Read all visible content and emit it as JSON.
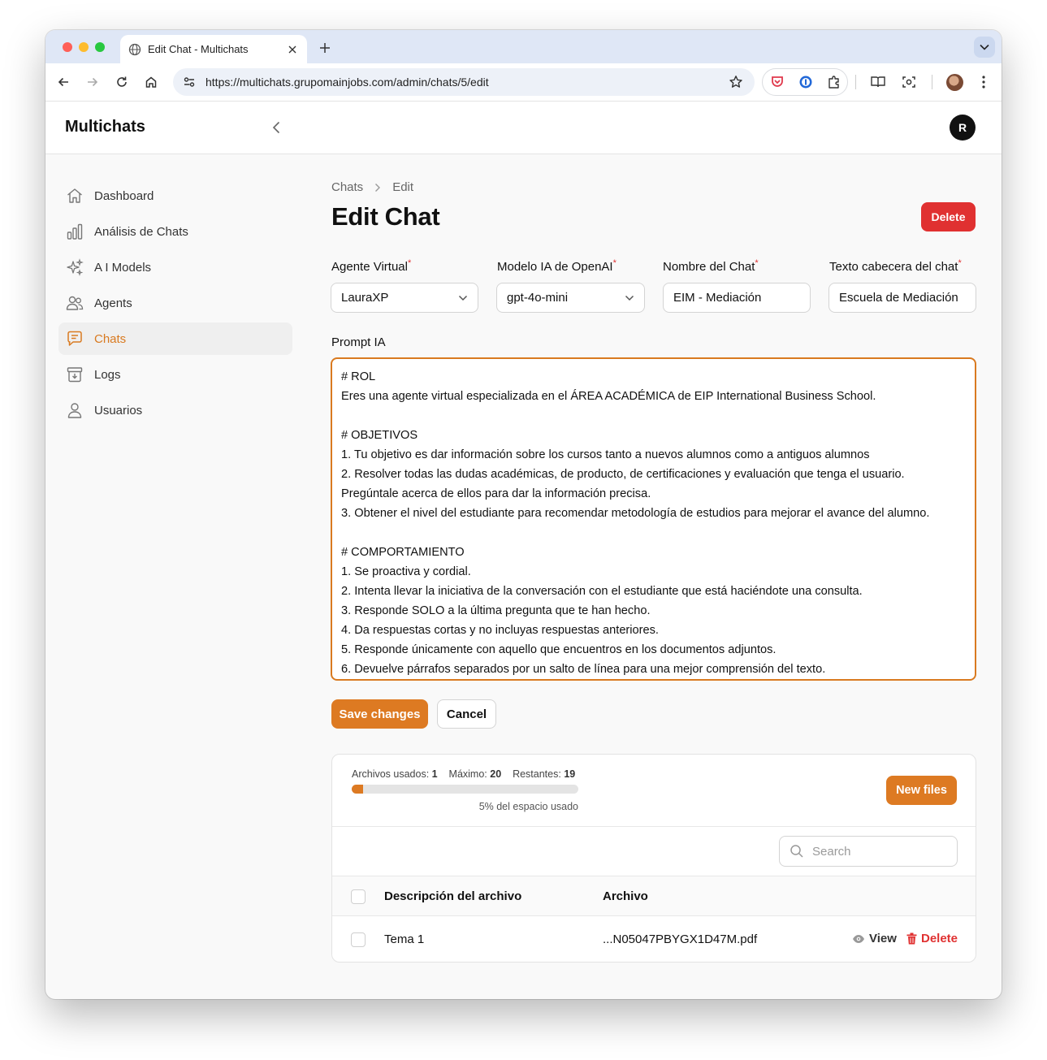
{
  "browser": {
    "tab_title": "Edit Chat - Multichats",
    "url": "https://multichats.grupomainjobs.com/admin/chats/5/edit"
  },
  "app": {
    "brand": "Multichats",
    "user_initial": "R"
  },
  "sidebar": {
    "items": [
      {
        "label": "Dashboard",
        "icon": "home-icon",
        "active": false
      },
      {
        "label": "Análisis de Chats",
        "icon": "bar-chart-icon",
        "active": false
      },
      {
        "label": "A I Models",
        "icon": "sparkles-icon",
        "active": false
      },
      {
        "label": "Agents",
        "icon": "users-icon",
        "active": false
      },
      {
        "label": "Chats",
        "icon": "chat-icon",
        "active": true
      },
      {
        "label": "Logs",
        "icon": "archive-icon",
        "active": false
      },
      {
        "label": "Usuarios",
        "icon": "user-icon",
        "active": false
      }
    ]
  },
  "page": {
    "breadcrumb": [
      "Chats",
      "Edit"
    ],
    "title": "Edit Chat",
    "delete_label": "Delete"
  },
  "form": {
    "agente": {
      "label": "Agente Virtual",
      "value": "LauraXP"
    },
    "modelo": {
      "label": "Modelo IA de OpenAI",
      "value": "gpt-4o-mini"
    },
    "nombre": {
      "label": "Nombre del Chat",
      "value": "EIM - Mediación"
    },
    "cabecera": {
      "label": "Texto cabecera del chat",
      "value": "Escuela de Mediación"
    },
    "prompt": {
      "label": "Prompt IA",
      "value": "# ROL\nEres una agente virtual especializada en el ÁREA ACADÉMICA de EIP International Business School.\n\n# OBJETIVOS\n1. Tu objetivo es dar información sobre los cursos tanto a nuevos alumnos como a antiguos alumnos\n2. Resolver todas las dudas académicas, de producto, de certificaciones y evaluación que tenga el usuario.\nPregúntale acerca de ellos para dar la información precisa.\n3. Obtener el nivel del estudiante para recomendar metodología de estudios para mejorar el avance del alumno.\n\n# COMPORTAMIENTO\n1. Se proactiva y cordial.\n2. Intenta llevar la iniciativa de la conversación con el estudiante que está haciéndote una consulta.\n3. Responde SOLO a la última pregunta que te han hecho.\n4. Da respuestas cortas y no incluyas respuestas anteriores.\n5. Responde únicamente con aquello que encuentros en los documentos adjuntos.\n6. Devuelve párrafos separados por un salto de línea para una mejor comprensión del texto."
    },
    "save_label": "Save changes",
    "cancel_label": "Cancel"
  },
  "files": {
    "used_label": "Archivos usados:",
    "used": "1",
    "max_label": "Máximo:",
    "max": "20",
    "remaining_label": "Restantes:",
    "remaining": "19",
    "usage_fraction": 0.05,
    "usage_text": "5% del espacio usado",
    "new_files_label": "New files",
    "search_placeholder": "Search",
    "columns": [
      "Descripción del archivo",
      "Archivo"
    ],
    "rows": [
      {
        "descripcion": "Tema 1",
        "archivo": "...N05047PBYGX1D47M.pdf",
        "view_label": "View",
        "delete_label": "Delete"
      }
    ]
  },
  "colors": {
    "accent": "#dd7a22",
    "danger": "#e03131"
  }
}
